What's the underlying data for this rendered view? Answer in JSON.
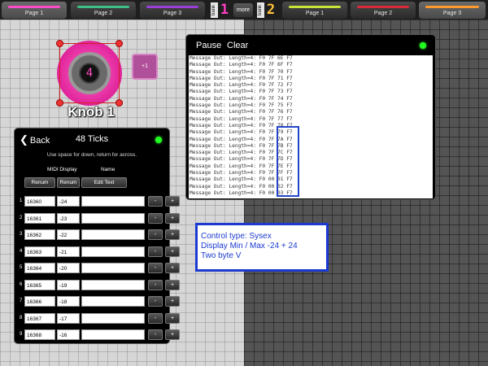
{
  "topbar": {
    "left_tabs": [
      {
        "label": "Page 1",
        "stripe": "#ff4cc8"
      },
      {
        "label": "Page 2",
        "stripe": "#3fbf86"
      },
      {
        "label": "Page 3",
        "stripe": "#9a3fd6"
      }
    ],
    "bank_left": {
      "label": "bank",
      "number": "1",
      "color": "#ff3cc4"
    },
    "more_label": "more",
    "bank_right": {
      "label": "bank",
      "number": "2",
      "color": "#ffc23a"
    },
    "right_tabs": [
      {
        "label": "Page 1",
        "stripe": "#c9e23a"
      },
      {
        "label": "Page 2",
        "stripe": "#d82b3a"
      },
      {
        "label": "Page 3",
        "stripe": "#ff9a2e"
      }
    ]
  },
  "knob": {
    "label": "Knob 1",
    "value": "4",
    "accent": "#ff3cc4"
  },
  "plus_button": {
    "label": "+1"
  },
  "log": {
    "pause_label": "Pause",
    "clear_label": "Clear",
    "lines": [
      "Message Out: Length=4: F0 7F 6E F7",
      "Message Out: Length=4: F0 7F 6F F7",
      "Message Out: Length=4: F0 7F 70 F7",
      "Message Out: Length=4: F0 7F 71 F7",
      "Message Out: Length=4: F0 7F 72 F7",
      "Message Out: Length=4: F0 7F 73 F7",
      "Message Out: Length=4: F0 7F 74 F7",
      "Message Out: Length=4: F0 7F 75 F7",
      "Message Out: Length=4: F0 7F 76 F7",
      "Message Out: Length=4: F0 7F 77 F7",
      "Message Out: Length=4: F0 7F 78 F7",
      "Message Out: Length=4: F0 7F 79 F7",
      "Message Out: Length=4: F0 7F 7A F7",
      "Message Out: Length=4: F0 7F 7B F7",
      "Message Out: Length=4: F0 7F 7C F7",
      "Message Out: Length=4: F0 7F 7D F7",
      "Message Out: Length=4: F0 7F 7E F7",
      "Message Out: Length=4: F0 7F 7F F7",
      "Message Out: Length=4: F0 00 01 F7",
      "Message Out: Length=4: F0 00 02 F7",
      "Message Out: Length=4: F0 00 03 F7"
    ]
  },
  "annotation": {
    "line1": "Control type: Sysex",
    "line2": "Display Min / Max -24 + 24",
    "line3": "Two byte V"
  },
  "ticks": {
    "back_label": "Back",
    "title": "48 Ticks",
    "hint": "Use space for down, return for across.",
    "col_midi": "MIDI",
    "col_display": "Display",
    "col_name": "Name",
    "renum_midi": "Renum",
    "renum_display": "Renum",
    "edit_text": "Edit Text",
    "rows": [
      {
        "idx": "1",
        "midi": "16360",
        "display": "-24",
        "name": ""
      },
      {
        "idx": "2",
        "midi": "16361",
        "display": "-23",
        "name": ""
      },
      {
        "idx": "3",
        "midi": "16362",
        "display": "-22",
        "name": ""
      },
      {
        "idx": "4",
        "midi": "16363",
        "display": "-21",
        "name": ""
      },
      {
        "idx": "5",
        "midi": "16364",
        "display": "-20",
        "name": ""
      },
      {
        "idx": "6",
        "midi": "16365",
        "display": "-19",
        "name": ""
      },
      {
        "idx": "7",
        "midi": "16366",
        "display": "-18",
        "name": ""
      },
      {
        "idx": "8",
        "midi": "16367",
        "display": "-17",
        "name": ""
      },
      {
        "idx": "9",
        "midi": "16368",
        "display": "-16",
        "name": ""
      }
    ],
    "minus_label": "-",
    "plus_label": "+"
  }
}
